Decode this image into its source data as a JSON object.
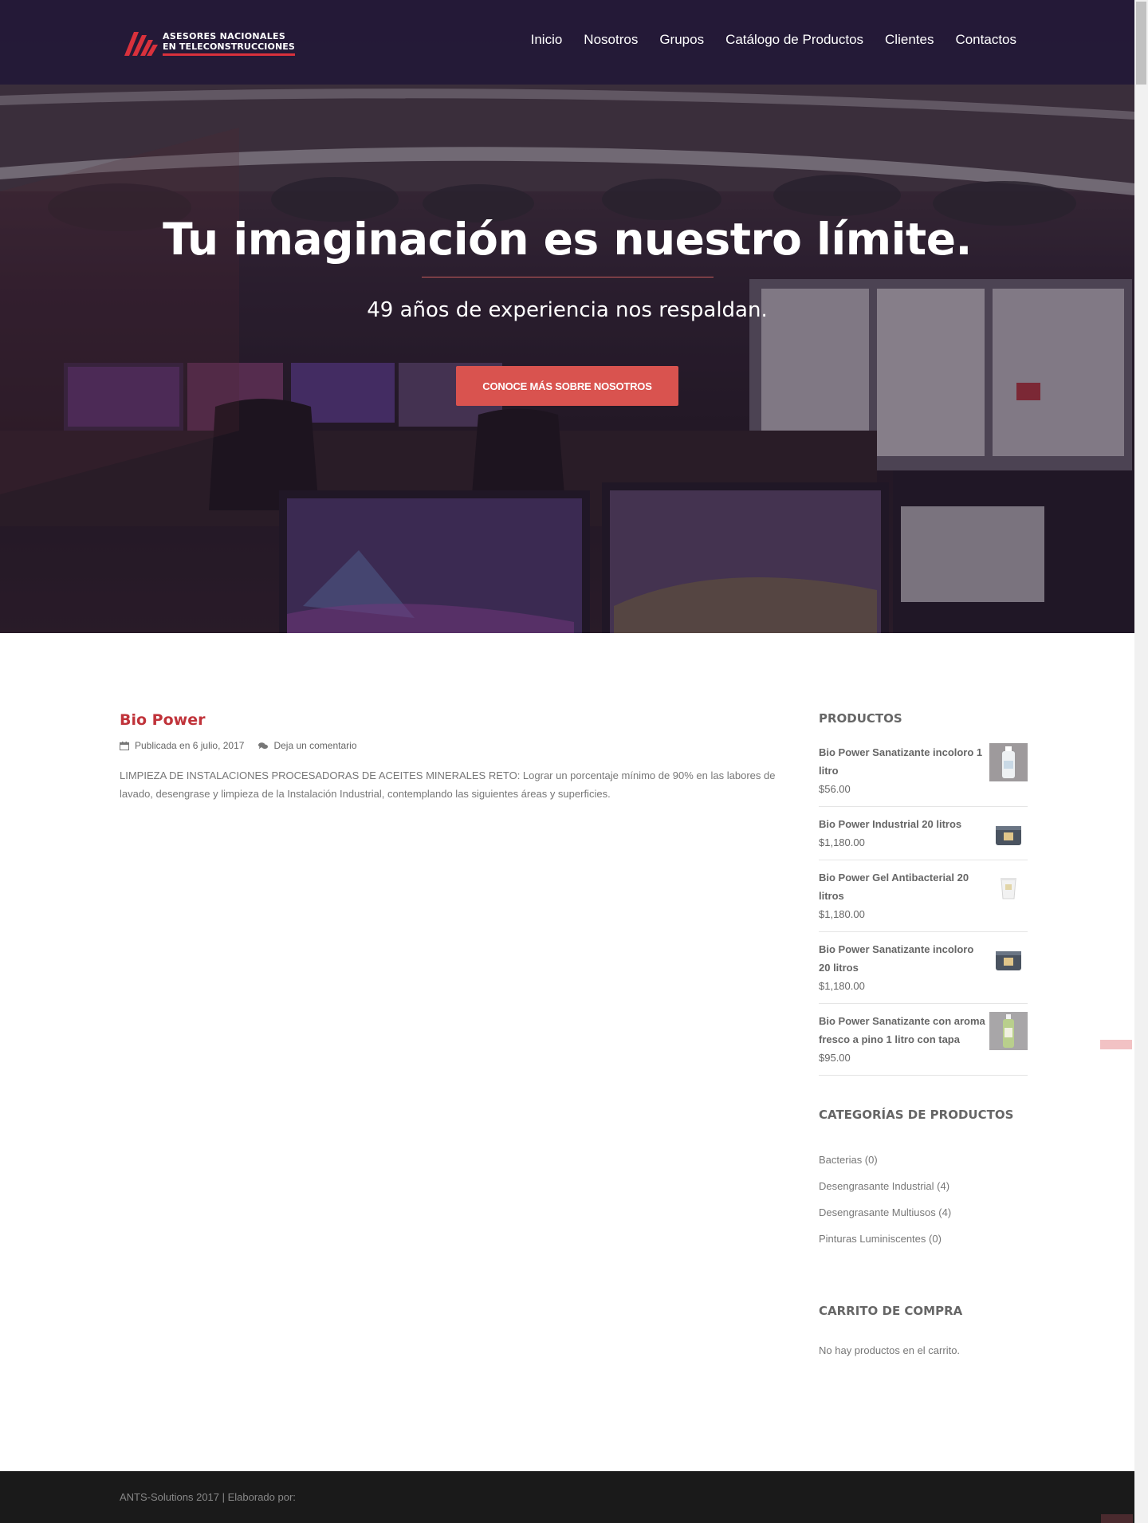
{
  "brand": {
    "line1": "ASESORES NACIONALES",
    "line2": "EN TELECONSTRUCCIONES",
    "accent": "#d9313c"
  },
  "nav": {
    "items": [
      "Inicio",
      "Nosotros",
      "Grupos",
      "Catálogo de Productos",
      "Clientes",
      "Contactos"
    ]
  },
  "hero": {
    "title": "Tu imaginación es nuestro límite.",
    "subtitle": "49 años de experiencia nos respaldan.",
    "button": "CONOCE MÁS SOBRE NOSOTROS",
    "button_color": "#d9534f"
  },
  "post": {
    "title": "Bio Power",
    "date": "Publicada en 6 julio, 2017",
    "comment": "Deja un comentario",
    "body": "LIMPIEZA DE INSTALACIONES PROCESADORAS DE ACEITES MINERALES RETO: Lograr un porcentaje mínimo de 90% en las labores de lavado, desengrase y limpieza de la Instalación Industrial, contemplando las siguientes áreas y superficies."
  },
  "sidebar": {
    "products_title": "PRODUCTOS",
    "products": [
      {
        "name": "Bio Power Sanatizante incoloro 1 litro",
        "price": "$56.00",
        "icon": "bottle-icon"
      },
      {
        "name": "Bio Power Industrial 20 litros",
        "price": "$1,180.00",
        "icon": "container-icon"
      },
      {
        "name": "Bio Power Gel Antibacterial 20 litros",
        "price": "$1,180.00",
        "icon": "bucket-icon"
      },
      {
        "name": "Bio Power Sanatizante incoloro 20 litros",
        "price": "$1,180.00",
        "icon": "container-icon"
      },
      {
        "name": "Bio Power Sanatizante con aroma fresco a pino 1 litro con tapa",
        "price": "$95.00",
        "icon": "bottle-icon"
      }
    ],
    "categories_title": "CATEGORÍAS DE PRODUCTOS",
    "categories": [
      "Bacterias (0)",
      "Desengrasante Industrial (4)",
      "Desengrasante Multiusos (4)",
      "Pinturas Luminiscentes (0)"
    ],
    "cart_title": "CARRITO DE COMPRA",
    "cart_empty": "No hay productos en el carrito."
  },
  "footer": {
    "text": "ANTS-Solutions 2017 |   Elaborado por:"
  }
}
